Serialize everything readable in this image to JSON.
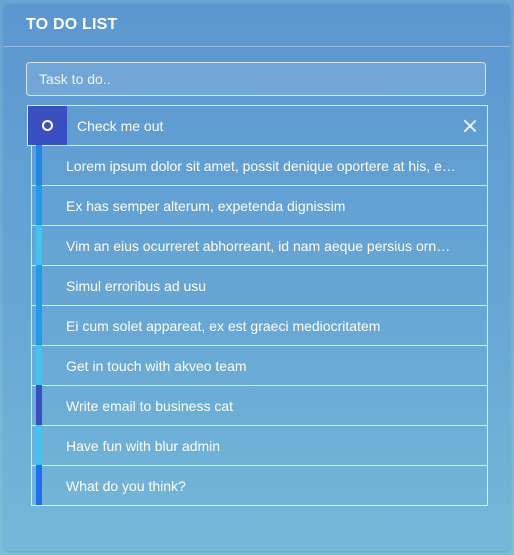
{
  "panel": {
    "title": "TO DO LIST"
  },
  "input": {
    "placeholder": "Task to do.."
  },
  "items": [
    {
      "label": "Check me out",
      "color": "#3b50c0"
    },
    {
      "label": "Lorem ipsum dolor sit amet, possit denique oportere at his, eti...",
      "color": "#1e88e5"
    },
    {
      "label": "Ex has semper alterum, expetenda dignissim",
      "color": "#209dea"
    },
    {
      "label": "Vim an eius ocurreret abhorreant, id nam aeque persius ornat...",
      "color": "#40c4f0"
    },
    {
      "label": "Simul erroribus ad usu",
      "color": "#209dea"
    },
    {
      "label": "Ei cum solet appareat, ex est graeci mediocritatem",
      "color": "#209dea"
    },
    {
      "label": "Get in touch with akveo team",
      "color": "#40c4f0"
    },
    {
      "label": "Write email to business cat",
      "color": "#3b50c0"
    },
    {
      "label": "Have fun with blur admin",
      "color": "#40c4f0"
    },
    {
      "label": "What do you think?",
      "color": "#1e6ef0"
    }
  ]
}
